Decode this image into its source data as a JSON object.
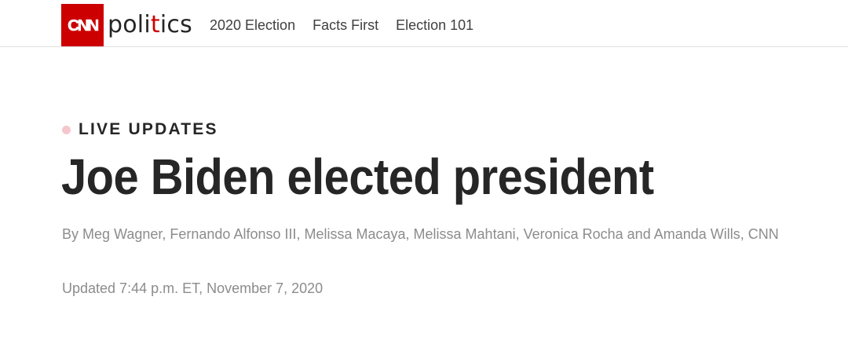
{
  "header": {
    "logo_text": "CNN",
    "section_prefix": "poli",
    "section_accent": "t",
    "section_suffix": "ics",
    "nav": [
      {
        "label": "2020 Election"
      },
      {
        "label": "Facts First"
      },
      {
        "label": "Election 101"
      }
    ]
  },
  "article": {
    "kicker": "LIVE UPDATES",
    "headline": "Joe Biden elected president",
    "byline": "By Meg Wagner, Fernando Alfonso III, Melissa Macaya, Melissa Mahtani, Veronica Rocha and Amanda Wills, CNN",
    "updated": "Updated 7:44 p.m. ET, November 7, 2020"
  },
  "colors": {
    "brand_red": "#cc0000",
    "live_dot": "#f5c6cb",
    "text_dark": "#262626",
    "text_muted": "#8c8c8c"
  }
}
